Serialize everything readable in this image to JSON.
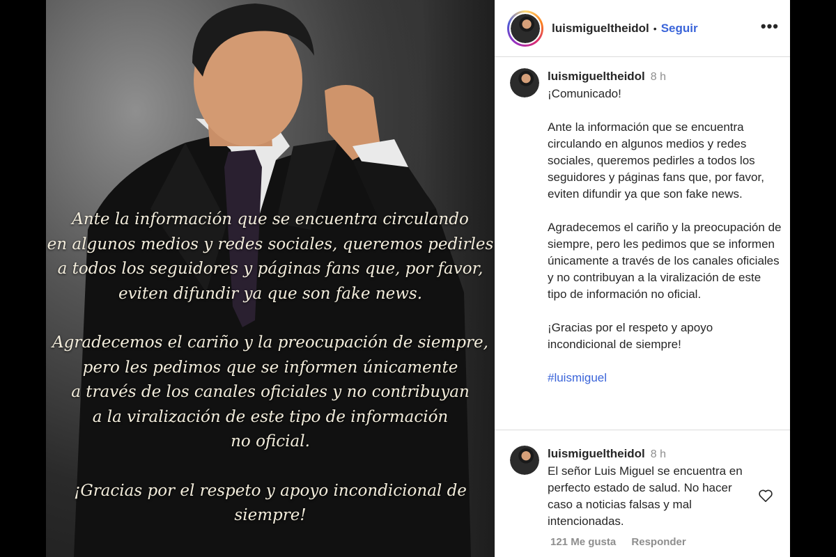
{
  "post": {
    "overlay_paragraphs": [
      [
        "Ante la información que se encuentra circulando",
        "en algunos medios y redes sociales, queremos pedirles",
        "a todos los seguidores y páginas fans que, por favor,",
        "eviten difundir ya que son fake news."
      ],
      [
        "Agradecemos el cariño y la preocupación de siempre,",
        "pero les pedimos que se informen únicamente",
        "a través de los canales oficiales y no contribuyan",
        "a la viralización de este tipo de información",
        "no oficial."
      ],
      [
        "¡Gracias por el respeto y apoyo incondicional de siempre!"
      ]
    ]
  },
  "header": {
    "username": "luismigueltheidol",
    "separator": "•",
    "follow_label": "Seguir",
    "more_label": "•••"
  },
  "caption": {
    "username": "luismigueltheidol",
    "time": "8 h",
    "paragraphs": [
      "¡Comunicado!",
      "Ante la información que se encuentra circulando en algunos medios y redes sociales, queremos pedirles a todos los seguidores y páginas fans que, por favor, eviten difundir ya que son fake news.",
      "Agradecemos el cariño y la preocupación de siempre, pero les pedimos que se informen únicamente a través de los canales oficiales y no contribuyan a la viralización  de este tipo de información no oficial.",
      "¡Gracias por el respeto y apoyo incondicional de siempre!"
    ],
    "hashtag": "#luismiguel"
  },
  "comment": {
    "username": "luismigueltheidol",
    "time": "8 h",
    "text": "El señor Luis Miguel se encuentra en perfecto estado de salud. No hacer caso a noticias falsas y mal intencionadas.",
    "likes": "121 Me gusta",
    "reply_label": "Responder"
  },
  "icons": {
    "heart": "heart-icon",
    "more": "more-icon"
  }
}
